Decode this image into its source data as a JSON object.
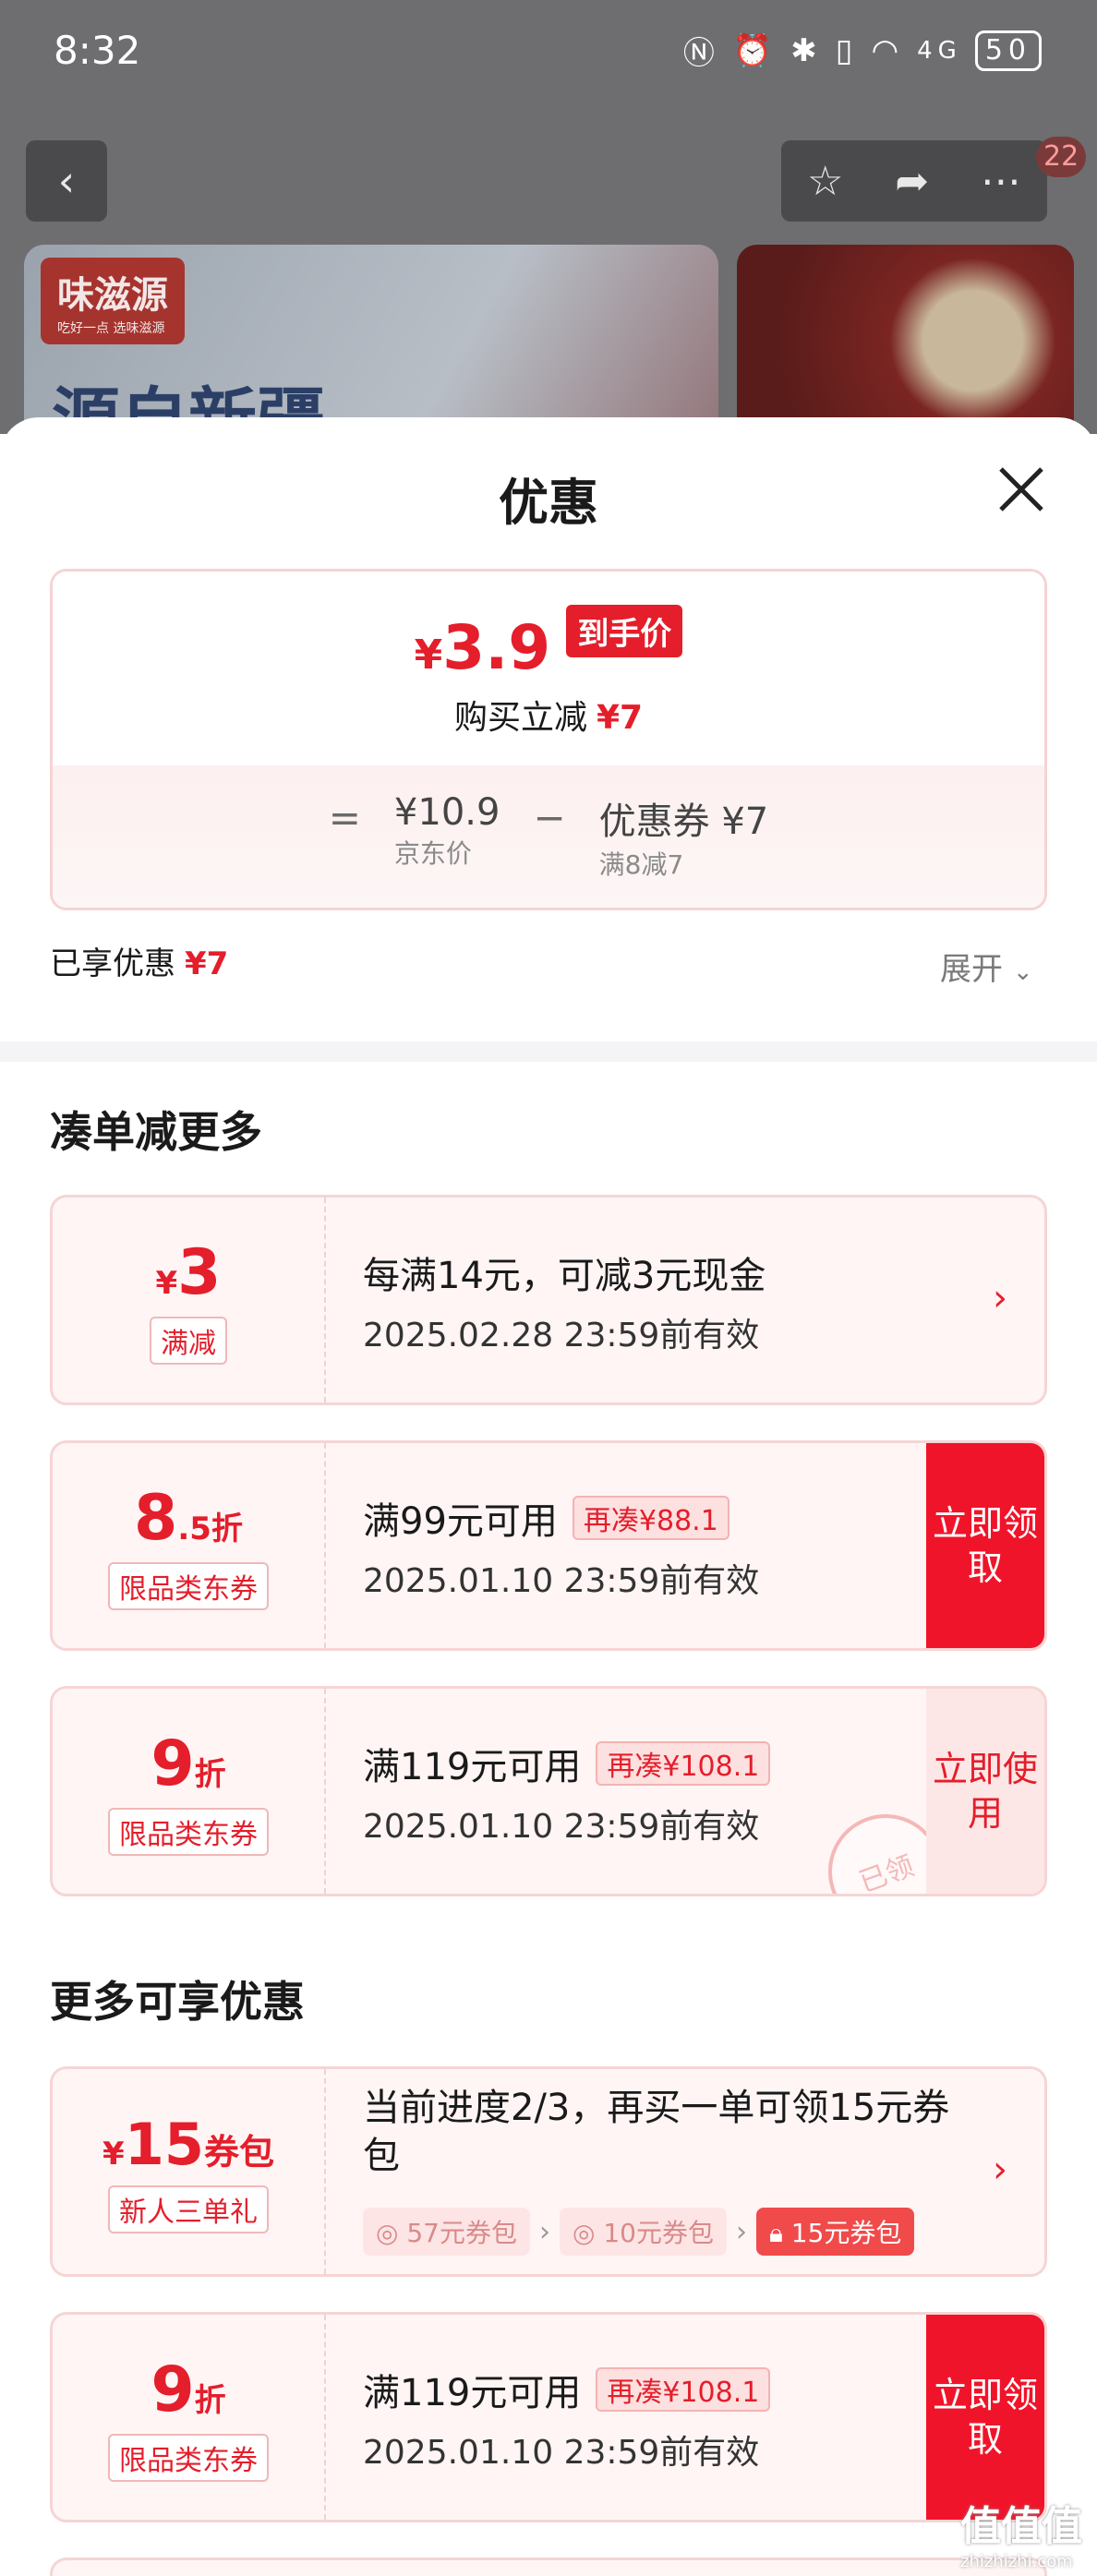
{
  "status_bar": {
    "time": "8:32",
    "battery": "50",
    "network": "4G"
  },
  "product_nav": {
    "badge_count": "22"
  },
  "banner": {
    "brand": "味滋源",
    "slogan": "吃好一点 选味滋源",
    "headline": "源自新疆"
  },
  "panel": {
    "title": "优惠",
    "price_card": {
      "currency": "¥",
      "final_price": "3.9",
      "final_tag": "到手价",
      "save_label": "购买立减",
      "save_value": "¥7",
      "equals": "=",
      "minus": "−",
      "jd_price": "¥10.9",
      "jd_price_label": "京东价",
      "coupon_label": "优惠券 ¥7",
      "coupon_rule": "满8减7"
    },
    "enjoyed_label": "已享优惠",
    "enjoyed_value": "¥7",
    "expand_label": "展开"
  },
  "section_more": {
    "title": "凑单减更多"
  },
  "coupons": [
    {
      "currency": "¥",
      "amount": "3",
      "tag": "满减",
      "main": "每满14元，可减3元现金",
      "sub": "2025.02.28 23:59前有效"
    },
    {
      "amount": "8",
      "amount_small": ".5折",
      "tag": "限品类东券",
      "main": "满99元可用",
      "gap": "再凑¥88.1",
      "sub": "2025.01.10 23:59前有效",
      "action": "立即领取"
    },
    {
      "amount": "9",
      "amount_small": "折",
      "tag": "限品类东券",
      "main": "满119元可用",
      "gap": "再凑¥108.1",
      "sub": "2025.01.10 23:59前有效",
      "action": "立即使用",
      "stamp": "已领"
    }
  ],
  "section_enjoy": {
    "title": "更多可享优惠"
  },
  "pack": {
    "currency": "¥",
    "amount": "15",
    "unit": "券包",
    "tag": "新人三单礼",
    "progress_text": "当前进度2/3，再买一单可领15元券包",
    "progress_fraction": 0.667,
    "steps": [
      "57元券包",
      "10元券包",
      "15元券包"
    ]
  },
  "coupon_last": {
    "amount": "9",
    "amount_small": "折",
    "tag": "限品类东券",
    "main": "满119元可用",
    "gap": "再凑¥108.1",
    "sub": "2025.01.10 23:59前有效",
    "action": "立即领取"
  },
  "watermark": {
    "text": "值值值",
    "site": "zhizhizhi.com"
  },
  "colors": {
    "accent": "#e41e2b",
    "claim_bg": "#f0142a",
    "coupon_bg": "#fff5f5"
  }
}
